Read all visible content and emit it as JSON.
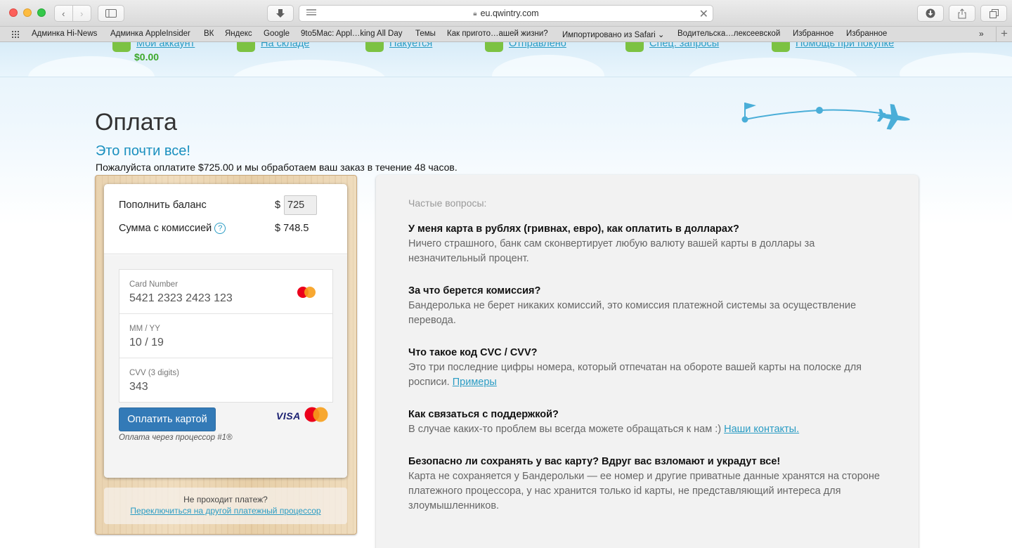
{
  "browser": {
    "url": "eu.qwintry.com",
    "bookmarks": [
      "Админка Hi-News",
      "Админка AppleInsider",
      "ВК",
      "Яндекс",
      "Google",
      "9to5Mac: Appl…king All Day",
      "Темы",
      "Как пригото…ашей жизни?",
      "Импортировано из Safari ⌄",
      "Водительска…лексеевской",
      "Избранное",
      "Избранное"
    ],
    "more": "»",
    "new_tab": "+"
  },
  "topnav": {
    "items": [
      "Мой аккаунт",
      "На складе",
      "Пакуется",
      "Отправлено",
      "Спец. запросы",
      "Помощь при покупке"
    ],
    "balance": "$0.00"
  },
  "page": {
    "title": "Оплата",
    "subtitle": "Это почти все!",
    "intro": "Пожалуйста оплатите $725.00 и мы обработаем ваш заказ в течение 48 часов."
  },
  "payment": {
    "top_up_label": "Пополнить баланс",
    "currency": "$",
    "amount": "725",
    "with_fee_label": "Сумма с комиссией",
    "help": "?",
    "with_fee_value": "$ 748.5",
    "card_number_label": "Card Number",
    "card_number": "5421 2323 2423 123",
    "expiry_label": "MM / YY",
    "expiry": "10 / 19",
    "cvv_label": "CVV (3 digits)",
    "cvv": "343",
    "pay_button": "Оплатить картой",
    "visa": "VISA",
    "processor_note": "Оплата через процессор #1®",
    "fallback_question": "Не проходит платеж?",
    "fallback_link": "Переключиться на другой платежный процессор"
  },
  "faq": {
    "heading": "Частые вопросы:",
    "items": [
      {
        "q": "У меня карта в рублях (гривнах, евро), как оплатить в долларах?",
        "a": "Ничего страшного, банк сам сконвертирует любую валюту вашей карты в доллары за незначительный процент."
      },
      {
        "q": "За что берется комиссия?",
        "a": "Бандеролька не берет никаких комиссий, это комиссия платежной системы за осуществление перевода."
      },
      {
        "q": "Что такое код CVC / CVV?",
        "a": "Это три последние цифры номера, который отпечатан на обороте вашей карты на полоске для росписи.",
        "link": "Примеры"
      },
      {
        "q": "Как связаться с поддержкой?",
        "a": "В случае каких-то проблем вы всегда можете обращаться к нам :)",
        "link": "Наши контакты."
      },
      {
        "q": "Безопасно ли сохранять у вас карту? Вдруг вас взломают и украдут все!",
        "a": "Карта не сохраняется у Бандерольки — ее номер и другие приватные данные хранятся на стороне платежного процессора, у нас хранится только id карты, не представляющий интереса для злоумышленников."
      }
    ]
  },
  "colors": {
    "accent": "#2a9cc4",
    "button": "#337ab7",
    "balance": "#3ca82a",
    "nav_icon": "#7cc242"
  }
}
